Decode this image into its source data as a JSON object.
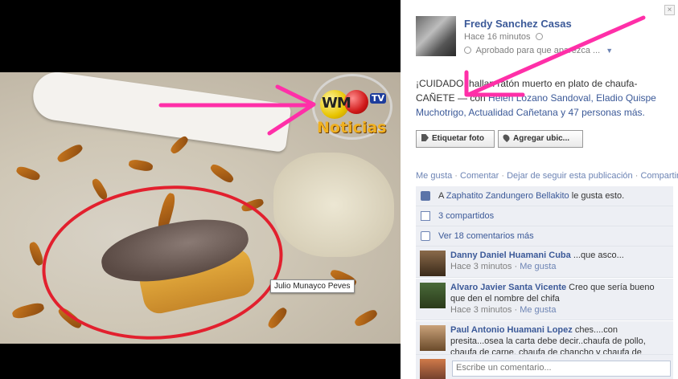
{
  "photo": {
    "tag_label": "Julio Munayco Peves",
    "logo_brand": "WM",
    "logo_tv": "TV",
    "logo_word": "Noticias"
  },
  "post": {
    "author": "Fredy Sanchez Casas",
    "time": "Hace 16 minutos",
    "approval": "Aprobado para que aparezca ...",
    "text_prefix": "¡CUIDADO! hallan ratón muerto en plato de chaufa-CAÑETE",
    "text_with": " — con ",
    "text_people": "Helen Lozano Sandoval, Eladio Quispe Muchotrigo, Actualidad Cañetana y 47 personas más.",
    "buttons": {
      "tag_photo": "Etiquetar foto",
      "add_location": "Agregar ubic..."
    },
    "actions": [
      "Me gusta",
      "Comentar",
      "Dejar de seguir esta publicación",
      "Compartir"
    ]
  },
  "ufi": {
    "likes_prefix": "A ",
    "likes_name": "Zaphatito Zandungero Bellakito",
    "likes_suffix": " le gusta esto.",
    "shares": "3 compartidos",
    "view_comments": "Ver 18 comentarios más"
  },
  "comments": [
    {
      "name": "Danny Daniel Huamani Cuba",
      "text": " ...que asco...",
      "time": "Hace 3 minutos",
      "like": "Me gusta"
    },
    {
      "name": "Alvaro Javier Santa Vicente",
      "text": " Creo que sería bueno que den el nombre del chifa",
      "time": "Hace 3 minutos",
      "like": "Me gusta"
    },
    {
      "name": "Paul Antonio Huamani Lopez",
      "text": " ches....con presita...osea la carta debe decir..chaufa de pollo, chaufa de carne, chaufa de chancho y chaufa de",
      "time": "",
      "like": ""
    }
  ],
  "composer": {
    "placeholder": "Escribe un comentario..."
  },
  "colors": {
    "link": "#3b5998",
    "arrow": "#ff2fa8",
    "ellipse": "#e2202e"
  }
}
